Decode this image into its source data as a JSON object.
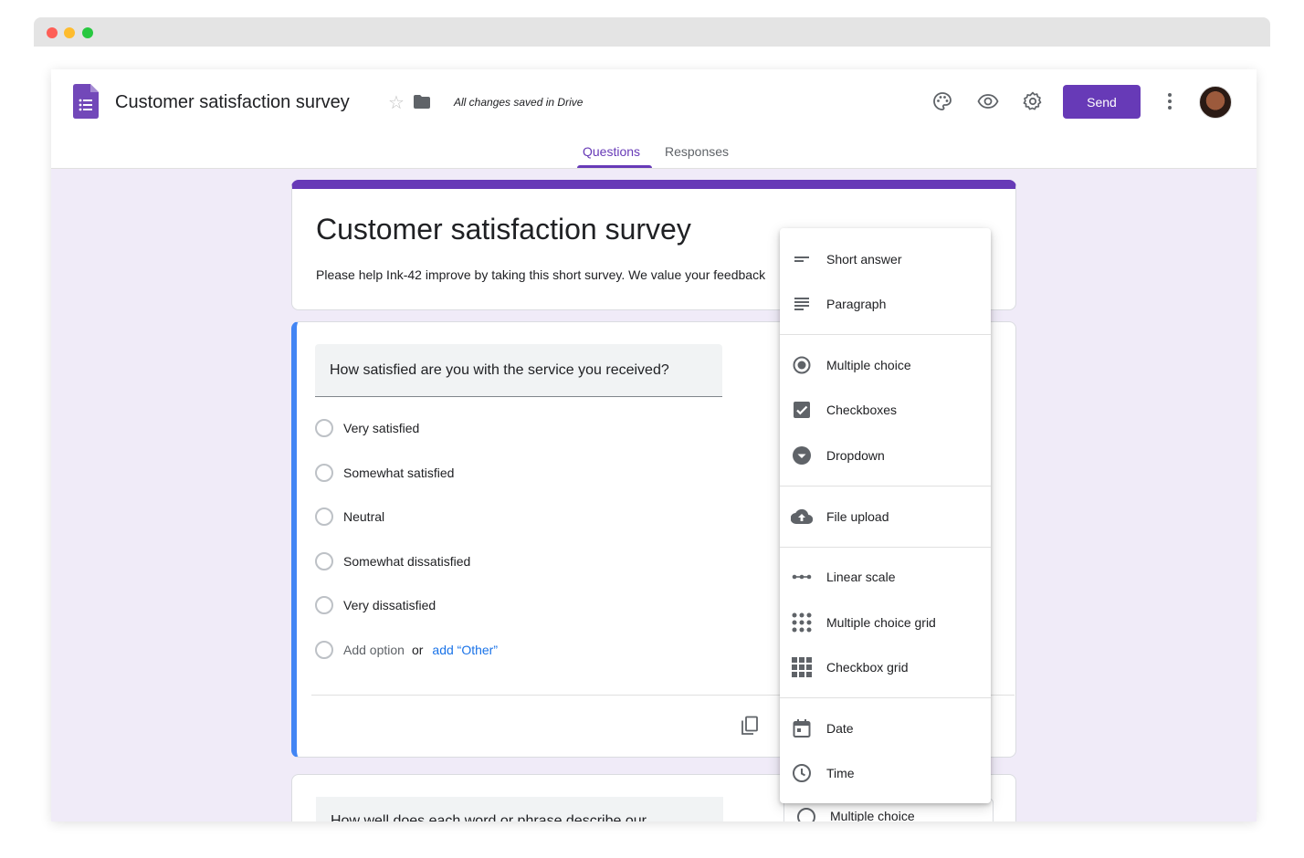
{
  "header": {
    "doc_title": "Customer satisfaction survey",
    "save_status": "All changes saved in Drive",
    "send_label": "Send"
  },
  "tabs": [
    {
      "label": "Questions",
      "active": true
    },
    {
      "label": "Responses",
      "active": false
    }
  ],
  "form": {
    "title": "Customer satisfaction survey",
    "description": "Please help Ink-42 improve by taking this short survey. We value your feedback"
  },
  "question1": {
    "text": "How satisfied are you with the service you received?",
    "options": [
      "Very satisfied",
      "Somewhat satisfied",
      "Neutral",
      "Somewhat dissatisfied",
      "Very dissatisfied"
    ],
    "add_option": "Add option",
    "or_label": "or",
    "add_other": "add “Other”"
  },
  "question2": {
    "text": "How well does each word or phrase describe our",
    "type_label": "Multiple choice"
  },
  "type_menu": {
    "items": [
      {
        "label": "Short answer",
        "icon": "short-answer-icon"
      },
      {
        "label": "Paragraph",
        "icon": "paragraph-icon"
      },
      {
        "label": "Multiple choice",
        "icon": "radio-icon"
      },
      {
        "label": "Checkboxes",
        "icon": "checkbox-icon"
      },
      {
        "label": "Dropdown",
        "icon": "dropdown-icon"
      },
      {
        "label": "File upload",
        "icon": "cloud-upload-icon"
      },
      {
        "label": "Linear scale",
        "icon": "linear-scale-icon"
      },
      {
        "label": "Multiple choice grid",
        "icon": "dot-grid-icon"
      },
      {
        "label": "Checkbox grid",
        "icon": "square-grid-icon"
      },
      {
        "label": "Date",
        "icon": "calendar-icon"
      },
      {
        "label": "Time",
        "icon": "clock-icon"
      }
    ]
  },
  "colors": {
    "accent": "#673ab7",
    "background": "#f0ebf8",
    "active_question_border": "#4285f4",
    "link": "#1a73e8"
  }
}
